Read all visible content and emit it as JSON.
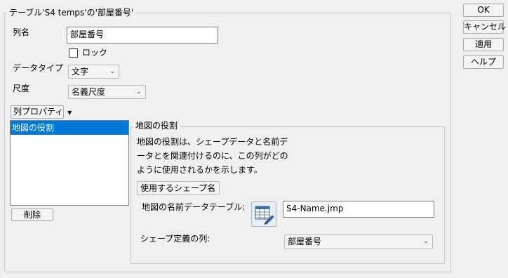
{
  "dialog": {
    "title": "テーブル'S4 temps'の'部屋番号'",
    "fields": {
      "column_name_label": "列名",
      "column_name_value": "部屋番号",
      "lock_label": "ロック",
      "lock_checked": false,
      "data_type_label": "データタイプ",
      "data_type_value": "文字",
      "modeling_type_label": "尺度",
      "modeling_type_value": "名義尺度"
    },
    "column_properties": {
      "menu_label": "列プロパティ",
      "items": [
        "地図の役割"
      ],
      "delete_button": "削除"
    },
    "map_role": {
      "title": "地図の役割",
      "description_lines": [
        "地図の役割は、シェープデータと名前デ",
        "ータとを関連付けるのに、この列がどの",
        "ように使用されるかを示します。"
      ],
      "role_select": "使用するシェープ名",
      "name_table_label": "地図の名前データテーブル:",
      "name_table_value": "S4-Name.jmp",
      "shape_column_label": "シェープ定義の列:",
      "shape_column_value": "部屋番号"
    }
  },
  "buttons": {
    "ok": "OK",
    "cancel": "キャンセル",
    "apply": "適用",
    "help": "ヘルプ"
  }
}
